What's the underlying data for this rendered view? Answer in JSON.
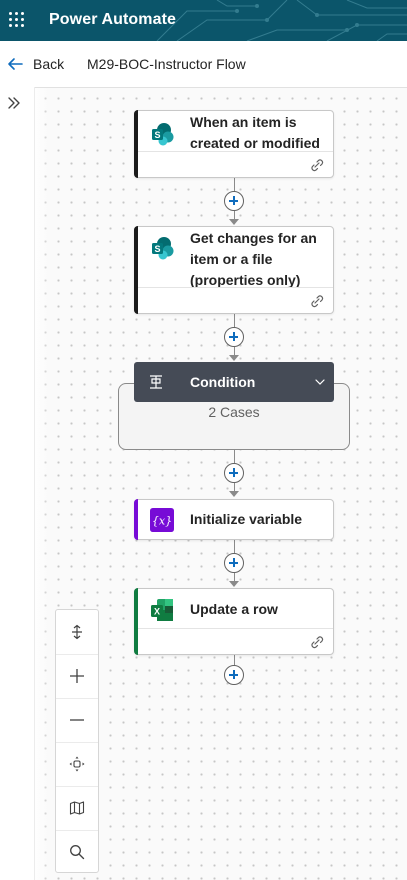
{
  "header": {
    "app_title": "Power Automate",
    "brand_color": "#0b556a"
  },
  "subbar": {
    "back_label": "Back",
    "flow_name": "M29-BOC-Instructor Flow"
  },
  "flow": {
    "trigger": {
      "title": "When an item is created or modified",
      "icon": "sharepoint-icon",
      "accent_color": "#1b1b1b"
    },
    "step2": {
      "title": "Get changes for an item or a file (properties only)",
      "icon": "sharepoint-icon",
      "accent_color": "#1b1b1b"
    },
    "condition": {
      "title": "Condition",
      "cases_text": "2 Cases",
      "header_color": "#454b56"
    },
    "step4": {
      "title": "Initialize variable",
      "icon": "variable-icon",
      "accent_color": "#770bd6"
    },
    "step5": {
      "title": "Update a row",
      "icon": "excel-icon",
      "accent_color": "#107c41"
    }
  },
  "toolbar": {
    "buttons": [
      "fit-height-icon",
      "zoom-in-icon",
      "zoom-out-icon",
      "fit-view-icon",
      "minimap-icon",
      "search-icon"
    ]
  }
}
